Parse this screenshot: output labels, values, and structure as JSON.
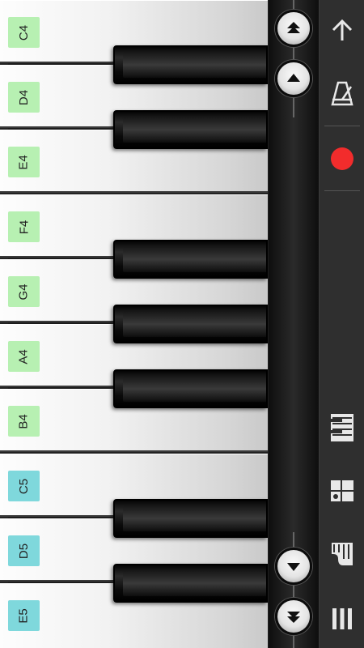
{
  "keyboard": {
    "white_keys": [
      {
        "note": "C4",
        "color": "green"
      },
      {
        "note": "D4",
        "color": "green"
      },
      {
        "note": "E4",
        "color": "green"
      },
      {
        "note": "F4",
        "color": "green"
      },
      {
        "note": "G4",
        "color": "green"
      },
      {
        "note": "A4",
        "color": "green"
      },
      {
        "note": "B4",
        "color": "green"
      },
      {
        "note": "C5",
        "color": "cyan"
      },
      {
        "note": "D5",
        "color": "cyan"
      },
      {
        "note": "E5",
        "color": "cyan"
      }
    ]
  },
  "strip": {
    "buttons": [
      "scroll-up-fast-button",
      "scroll-up-button",
      "scroll-down-button",
      "scroll-down-fast-button"
    ]
  },
  "toolbar": {
    "icons": [
      "back-arrow-icon",
      "metronome-icon",
      "record-icon",
      "keyboard-layout-icon",
      "dual-keyboard-icon",
      "instrument-piano-icon",
      "menu-icon"
    ],
    "record_color": "#f22c2c"
  },
  "colors": {
    "label_green": "#b7f0b2",
    "label_cyan": "#7fd8dc"
  }
}
